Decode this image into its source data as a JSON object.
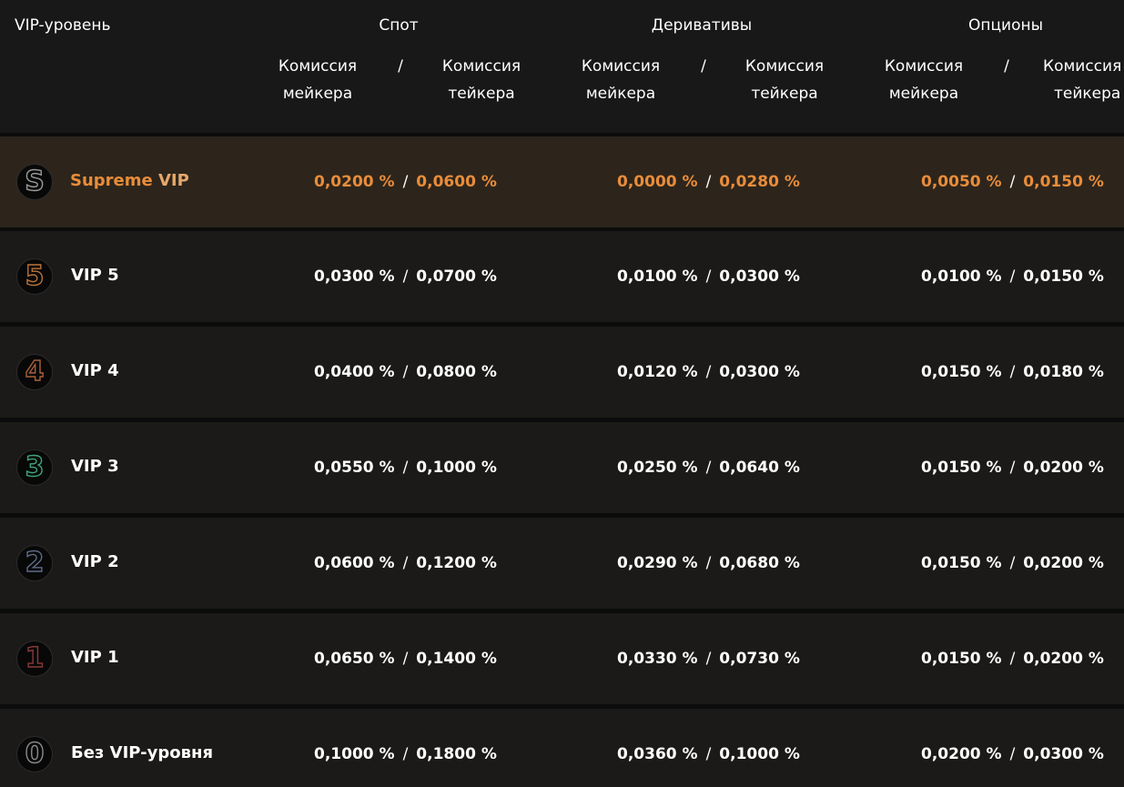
{
  "header": {
    "tier_label": "VIP-уровень",
    "groups": [
      {
        "title": "Спот",
        "maker_l1": "Комиссия",
        "maker_l2": "мейкера",
        "slash": "/",
        "taker_l1": "Комиссия",
        "taker_l2": "тейкера"
      },
      {
        "title": "Деривативы",
        "maker_l1": "Комиссия",
        "maker_l2": "мейкера",
        "slash": "/",
        "taker_l1": "Комиссия",
        "taker_l2": "тейкера"
      },
      {
        "title": "Опционы",
        "maker_l1": "Комиссия",
        "maker_l2": "мейкера",
        "slash": "/",
        "taker_l1": "Комиссия",
        "taker_l2": "тейкера"
      }
    ]
  },
  "colors": {
    "accent": "#e98d3a",
    "supreme_row_bg": "#2d251c",
    "row_bg": "#1b1a18",
    "header_bg": "#181818"
  },
  "rows": [
    {
      "badge_glyph": "S",
      "badge_icon": "supreme-badge-icon",
      "badge_color": "#9a9a9a",
      "name_a": "Supreme",
      "name_b": " VIP",
      "spot": {
        "maker_a": "0,0",
        "maker_b": "200 %",
        "taker_a": "0,0",
        "taker_b": "600 %"
      },
      "deriv": {
        "maker_a": "0,0",
        "maker_b": "000 %",
        "taker_a": "0,0",
        "taker_b": "280 %"
      },
      "opt": {
        "maker_a": "0,0",
        "maker_b": "050 %",
        "taker_a": "0,0",
        "taker_b": "150 %"
      },
      "sep": "/"
    },
    {
      "badge_glyph": "5",
      "badge_icon": "vip5-badge-icon",
      "badge_color": "#b8743a",
      "name": "VIP 5",
      "spot": {
        "maker": "0,0300 %",
        "taker": "0,0700 %"
      },
      "deriv": {
        "maker": "0,0100 %",
        "taker": "0,0300 %"
      },
      "opt": {
        "maker": "0,0100 %",
        "taker": "0,0150 %"
      },
      "sep": "/"
    },
    {
      "badge_glyph": "4",
      "badge_icon": "vip4-badge-icon",
      "badge_color": "#a7613a",
      "name": "VIP 4",
      "spot": {
        "maker": "0,0400 %",
        "taker": "0,0800 %"
      },
      "deriv": {
        "maker": "0,0120 %",
        "taker": "0,0300 %"
      },
      "opt": {
        "maker": "0,0150 %",
        "taker": "0,0180 %"
      },
      "sep": "/"
    },
    {
      "badge_glyph": "3",
      "badge_icon": "vip3-badge-icon",
      "badge_color": "#3fa57a",
      "name": "VIP 3",
      "spot": {
        "maker": "0,0550 %",
        "taker": "0,1000 %"
      },
      "deriv": {
        "maker": "0,0250 %",
        "taker": "0,0640 %"
      },
      "opt": {
        "maker": "0,0150 %",
        "taker": "0,0200 %"
      },
      "sep": "/"
    },
    {
      "badge_glyph": "2",
      "badge_icon": "vip2-badge-icon",
      "badge_color": "#5f6b86",
      "name": "VIP 2",
      "spot": {
        "maker": "0,0600 %",
        "taker": "0,1200 %"
      },
      "deriv": {
        "maker": "0,0290 %",
        "taker": "0,0680 %"
      },
      "opt": {
        "maker": "0,0150 %",
        "taker": "0,0200 %"
      },
      "sep": "/"
    },
    {
      "badge_glyph": "1",
      "badge_icon": "vip1-badge-icon",
      "badge_color": "#8a3a3a",
      "name": "VIP 1",
      "spot": {
        "maker": "0,0650 %",
        "taker": "0,1400 %"
      },
      "deriv": {
        "maker": "0,0330 %",
        "taker": "0,0730 %"
      },
      "opt": {
        "maker": "0,0150 %",
        "taker": "0,0200 %"
      },
      "sep": "/"
    },
    {
      "badge_glyph": "0",
      "badge_icon": "novip-badge-icon",
      "badge_color": "#8a8a8a",
      "name": "Без VIP-уровня",
      "spot": {
        "maker": "0,1000 %",
        "taker": "0,1800 %"
      },
      "deriv": {
        "maker": "0,0360 %",
        "taker": "0,1000 %"
      },
      "opt": {
        "maker": "0,0200 %",
        "taker": "0,0300 %"
      },
      "sep": "/"
    }
  ]
}
